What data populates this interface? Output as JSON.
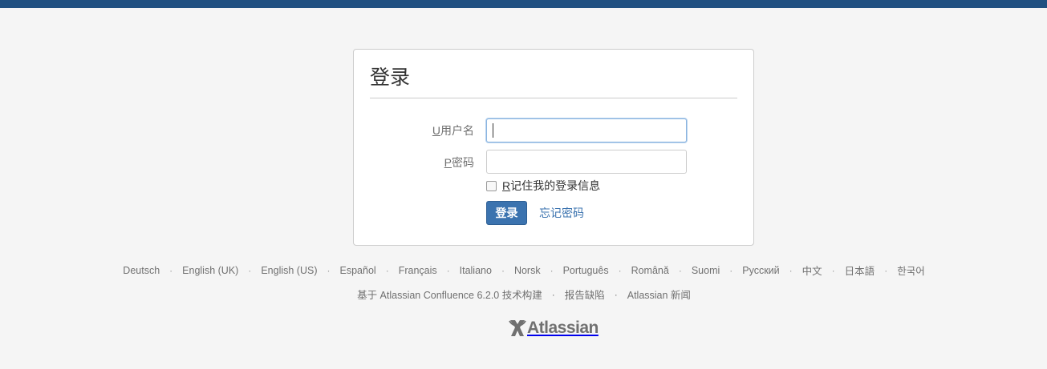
{
  "login": {
    "title": "登录",
    "username_accesskey": "U",
    "username_label": "用户名",
    "username_value": "",
    "password_accesskey": "P",
    "password_label": "密码",
    "password_value": "",
    "remember_accesskey": "R",
    "remember_label": "记住我的登录信息",
    "remember_checked": false,
    "submit_label": "登录",
    "forgot_label": "忘记密码"
  },
  "languages": [
    "Deutsch",
    "English (UK)",
    "English (US)",
    "Español",
    "Français",
    "Italiano",
    "Norsk",
    "Português",
    "Română",
    "Suomi",
    "Русский",
    "中文",
    "日本語",
    "한국어"
  ],
  "footer": {
    "powered_by": "基于 Atlassian Confluence 6.2.0 技术构建",
    "report_bug": "报告缺陷",
    "news": "Atlassian 新闻",
    "separator": "·"
  },
  "logo": {
    "text": "Atlassian",
    "icon": "atlassian-logo-icon"
  },
  "colors": {
    "header": "#205081",
    "primary": "#3b73af",
    "background": "#f5f5f5"
  }
}
